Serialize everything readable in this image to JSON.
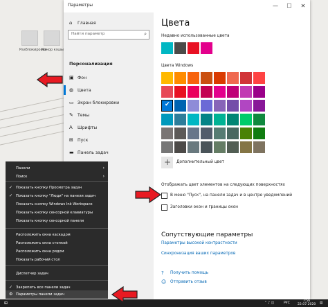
{
  "window": {
    "title": "Параметры",
    "minimize": "—",
    "maximize": "☐",
    "close": "✕"
  },
  "desktop": {
    "icons": [
      "Разблокировки",
      "Хонор кэшыми"
    ]
  },
  "sidebar": {
    "home": "Главная",
    "search_placeholder": "Найти параметр",
    "section": "Персонализация",
    "items": [
      {
        "label": "Фон",
        "icon": "image-icon"
      },
      {
        "label": "Цвета",
        "icon": "palette-icon"
      },
      {
        "label": "Экран блокировки",
        "icon": "lock-screen-icon"
      },
      {
        "label": "Темы",
        "icon": "themes-icon"
      },
      {
        "label": "Шрифты",
        "icon": "fonts-icon"
      },
      {
        "label": "Пуск",
        "icon": "start-icon"
      },
      {
        "label": "Панель задач",
        "icon": "taskbar-icon"
      }
    ]
  },
  "content": {
    "title": "Цвета",
    "recent_label": "Недавно использованные цвета",
    "recent_colors": [
      "#00b7c3",
      "#4c4a48",
      "#e81123",
      "#e3008c"
    ],
    "windows_label": "Цвета Windows",
    "windows_colors": [
      [
        "#ffb900",
        "#ff8c00",
        "#f7630c",
        "#ca5010",
        "#da3b01",
        "#ef6950",
        "#d13438",
        "#ff4343"
      ],
      [
        "#e74856",
        "#e81123",
        "#ea005e",
        "#c30052",
        "#e3008c",
        "#bf0077",
        "#c239b3",
        "#9a0089"
      ],
      [
        "#0078d7",
        "#0063b1",
        "#8e8cd8",
        "#6b69d6",
        "#8764b8",
        "#744da9",
        "#b146c2",
        "#881798"
      ],
      [
        "#0099bc",
        "#2d7d9a",
        "#00b7c3",
        "#038387",
        "#00b294",
        "#018574",
        "#00cc6a",
        "#10893e"
      ],
      [
        "#7a7574",
        "#5d5a58",
        "#68768a",
        "#515c6b",
        "#567c73",
        "#486860",
        "#498205",
        "#107c10"
      ],
      [
        "#767676",
        "#4c4a48",
        "#69797e",
        "#4a5459",
        "#647c64",
        "#525e54",
        "#847545",
        "#7e735f"
      ]
    ],
    "selected_color": "#0078d7",
    "custom_label": "Дополнительный цвет",
    "surfaces_label": "Отображать цвет элементов на следующих поверхностях",
    "option_start": "В меню \"Пуск\", на панели задач и в центре уведомлений",
    "option_titlebars": "Заголовки окон и границы окон",
    "related_title": "Сопутствующие параметры",
    "link_contrast": "Параметры высокой контрастности",
    "link_sync": "Синхронизация ваших параметров",
    "help": "Получить помощь",
    "feedback": "Отправить отзыв"
  },
  "context_menu": {
    "items": [
      {
        "label": "Панели",
        "arrow": "›",
        "check": ""
      },
      {
        "label": "Поиск",
        "arrow": "›",
        "check": ""
      },
      {
        "label": "Показать кнопку Просмотра задач",
        "arrow": "",
        "check": "✓"
      },
      {
        "label": "Показать кнопку \"Люди\" на панели задач",
        "arrow": "",
        "check": "✓"
      },
      {
        "label": "Показать кнопку Windows Ink Workspace",
        "arrow": "",
        "check": ""
      },
      {
        "label": "Показать кнопку сенсорной клавиатуры",
        "arrow": "",
        "check": ""
      },
      {
        "label": "Показать кнопку сенсорной панели",
        "arrow": "",
        "check": ""
      },
      {
        "label": "Расположить окна каскадом",
        "arrow": "",
        "check": ""
      },
      {
        "label": "Расположить окна стопкой",
        "arrow": "",
        "check": ""
      },
      {
        "label": "Расположить окна рядом",
        "arrow": "",
        "check": ""
      },
      {
        "label": "Показать рабочий стол",
        "arrow": "",
        "check": ""
      },
      {
        "label": "Диспетчер задач",
        "arrow": "",
        "check": ""
      },
      {
        "label": "Закрепить все панели задач",
        "arrow": "",
        "check": "✓"
      },
      {
        "label": "Параметры панели задач",
        "arrow": "",
        "check": "⚙"
      }
    ]
  },
  "taskbar": {
    "lang": "РУС",
    "time": "7:56",
    "date": "22.07.2020"
  }
}
